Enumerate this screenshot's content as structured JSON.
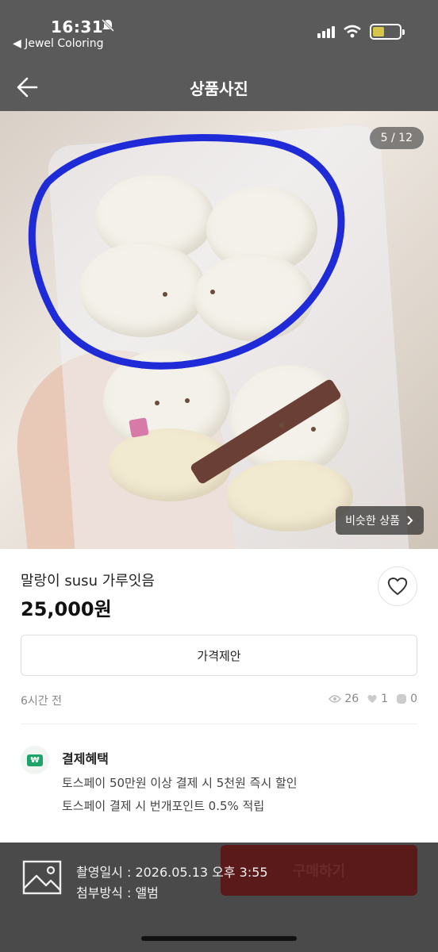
{
  "status": {
    "time": "16:31",
    "back_app": "◀ Jewel Coloring",
    "battery_level": 0.45
  },
  "nav": {
    "title": "상품사진",
    "icons": [
      "back-arrow-icon",
      "home-icon",
      "search-icon",
      "cart-icon"
    ]
  },
  "photo": {
    "pager": "5 / 12",
    "similar_label": "비슷한 상품",
    "annotation_color": "#1f2bd6"
  },
  "product": {
    "title": "말랑이 susu 가루잇음",
    "price": "25,000원",
    "offer_label": "가격제안",
    "posted": "6시간 전",
    "views": "26",
    "likes": "1",
    "chats": "0"
  },
  "benefit": {
    "badge": "₩",
    "title": "결제혜택",
    "lines": [
      "토스페이 50만원 이상 결제 시 5천원 즉시 할인",
      "토스페이 결제 시 번개포인트 0.5% 적립"
    ]
  },
  "bottom": {
    "buy_label": "구매하기",
    "taken_at": "촬영일시 : 2026.05.13 오후 3:55",
    "attach_method": "첨부방식 : 앨범"
  },
  "colors": {
    "header_bg": "#5a5a5a",
    "buy_button": "#5a1a1a",
    "benefit_badge": "#1ea36a"
  }
}
